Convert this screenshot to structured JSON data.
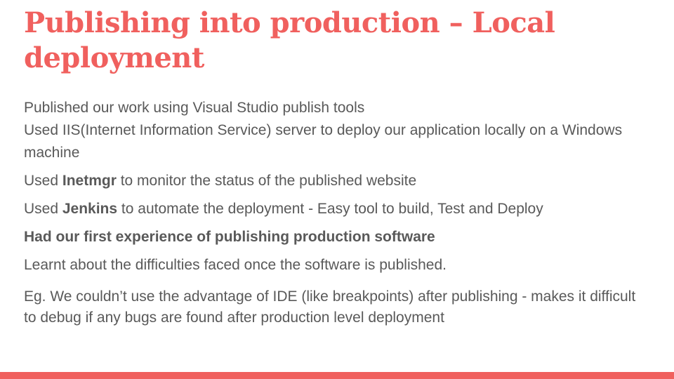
{
  "slide": {
    "accent_color": "#f0605e",
    "text_color": "#595959",
    "title": "Publishing into production – Local deployment",
    "p1_line1": "Published our work using Visual Studio publish tools",
    "p1_line2": "Used IIS(Internet Information Service) server to deploy our application locally on a Windows machine",
    "p2_before": "Used ",
    "p2_bold": "Inetmgr",
    "p2_after": " to monitor the status of the published website",
    "p3_before": "Used ",
    "p3_bold": "Jenkins",
    "p3_after": " to automate the deployment - Easy tool to build, Test and Deploy",
    "p4": "Had our first experience of publishing production software",
    "p5": "Learnt about the difficulties faced once the software is published.",
    "p6": "Eg. We couldn’t use the advantage of IDE (like breakpoints) after publishing - makes it difficult to debug if any bugs are found  after production level deployment"
  }
}
